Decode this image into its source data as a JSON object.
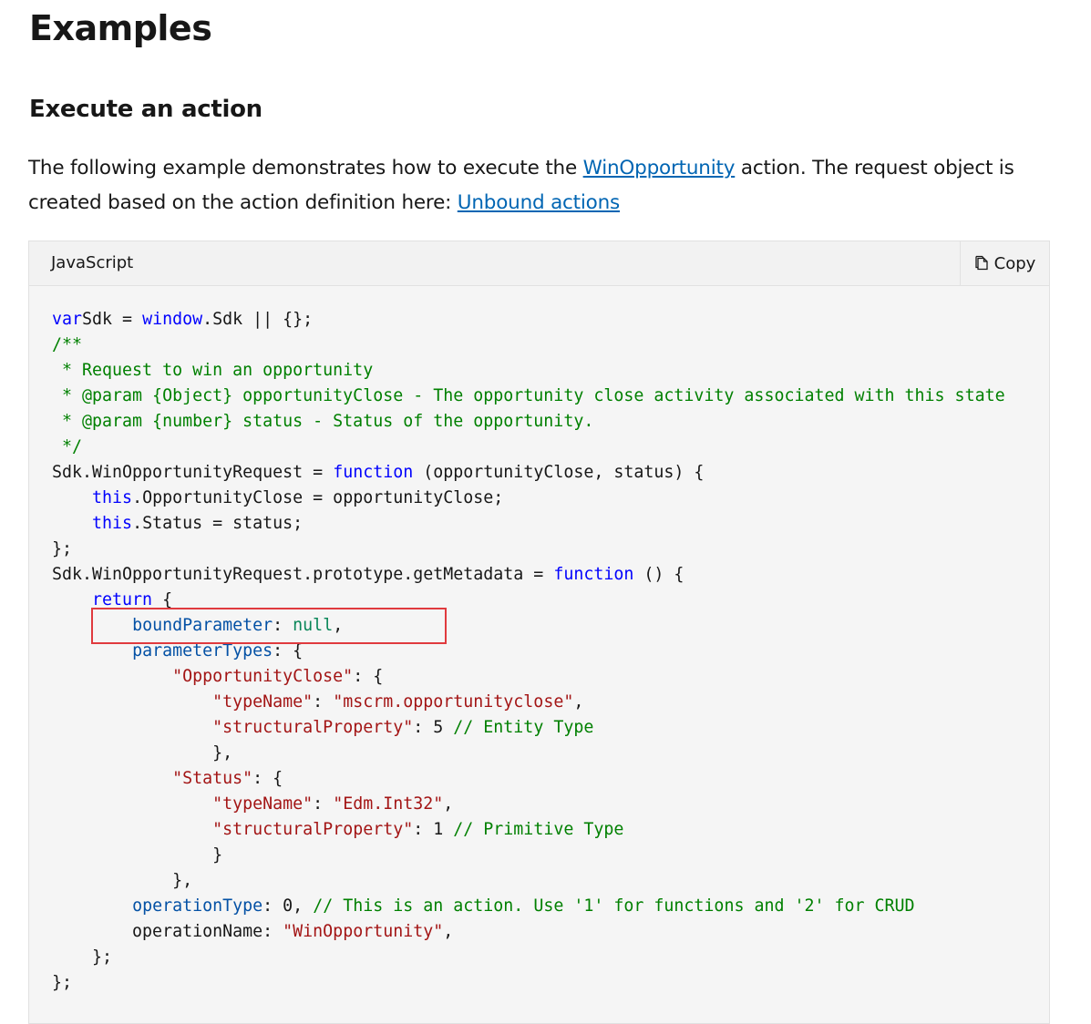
{
  "heading": "Examples",
  "subheading": "Execute an action",
  "paragraph": {
    "text1": "The following example demonstrates how to execute the ",
    "link1": "WinOpportunity",
    "text2": " action. The request object is created based on the action definition here: ",
    "link2": "Unbound actions"
  },
  "code_block": {
    "language": "JavaScript",
    "copy_label": "Copy",
    "copy_icon": "copy-icon",
    "lines": [
      [
        [
          "kw",
          "var"
        ],
        [
          "",
          "Sdk = "
        ],
        [
          "kw",
          "window"
        ],
        [
          "",
          ".Sdk || {};"
        ]
      ],
      [
        [
          "cm",
          "/**"
        ]
      ],
      [
        [
          "cm",
          " * Request to win an opportunity"
        ]
      ],
      [
        [
          "cm",
          " * @param {Object} opportunityClose - The opportunity close activity associated with this state"
        ]
      ],
      [
        [
          "cm",
          " * @param {number} status - Status of the opportunity."
        ]
      ],
      [
        [
          "cm",
          " */"
        ]
      ],
      [
        [
          "",
          "Sdk.WinOpportunityRequest = "
        ],
        [
          "kw",
          "function"
        ],
        [
          "",
          " (opportunityClose, status) {"
        ]
      ],
      [
        [
          "",
          "    "
        ],
        [
          "kw",
          "this"
        ],
        [
          "",
          ".OpportunityClose = opportunityClose;"
        ]
      ],
      [
        [
          "",
          "    "
        ],
        [
          "kw",
          "this"
        ],
        [
          "",
          ".Status = status;"
        ]
      ],
      [
        [
          "",
          "};"
        ]
      ],
      [
        [
          "",
          "Sdk.WinOpportunityRequest.prototype.getMetadata = "
        ],
        [
          "kw",
          "function"
        ],
        [
          "",
          " () {"
        ]
      ],
      [
        [
          "",
          "    "
        ],
        [
          "kw",
          "return"
        ],
        [
          "",
          " {"
        ]
      ],
      [
        [
          "",
          "        "
        ],
        [
          "prop",
          "boundParameter"
        ],
        [
          "",
          ": "
        ],
        [
          "lit",
          "null"
        ],
        [
          "",
          ","
        ]
      ],
      [
        [
          "",
          "        "
        ],
        [
          "prop",
          "parameterTypes"
        ],
        [
          "",
          ": {"
        ]
      ],
      [
        [
          "",
          "            "
        ],
        [
          "str",
          "\"OpportunityClose\""
        ],
        [
          "",
          ": {"
        ]
      ],
      [
        [
          "",
          "                "
        ],
        [
          "str",
          "\"typeName\""
        ],
        [
          "",
          ": "
        ],
        [
          "str",
          "\"mscrm.opportunityclose\""
        ],
        [
          "",
          ","
        ]
      ],
      [
        [
          "",
          "                "
        ],
        [
          "str",
          "\"structuralProperty\""
        ],
        [
          "",
          ": 5 "
        ],
        [
          "cm",
          "// Entity Type"
        ]
      ],
      [
        [
          "",
          "                },"
        ]
      ],
      [
        [
          "",
          "            "
        ],
        [
          "str",
          "\"Status\""
        ],
        [
          "",
          ": {"
        ]
      ],
      [
        [
          "",
          "                "
        ],
        [
          "str",
          "\"typeName\""
        ],
        [
          "",
          ": "
        ],
        [
          "str",
          "\"Edm.Int32\""
        ],
        [
          "",
          ","
        ]
      ],
      [
        [
          "",
          "                "
        ],
        [
          "str",
          "\"structuralProperty\""
        ],
        [
          "",
          ": 1 "
        ],
        [
          "cm",
          "// Primitive Type"
        ]
      ],
      [
        [
          "",
          "                }"
        ]
      ],
      [
        [
          "",
          "            },"
        ]
      ],
      [
        [
          "",
          "        "
        ],
        [
          "prop",
          "operationType"
        ],
        [
          "",
          ": 0, "
        ],
        [
          "cm",
          "// This is an action. Use '1' for functions and '2' for CRUD"
        ]
      ],
      [
        [
          "",
          "        operationName: "
        ],
        [
          "str",
          "\"WinOpportunity\""
        ],
        [
          "",
          ","
        ]
      ],
      [
        [
          "",
          "    };"
        ]
      ],
      [
        [
          "",
          "};"
        ]
      ]
    ]
  }
}
